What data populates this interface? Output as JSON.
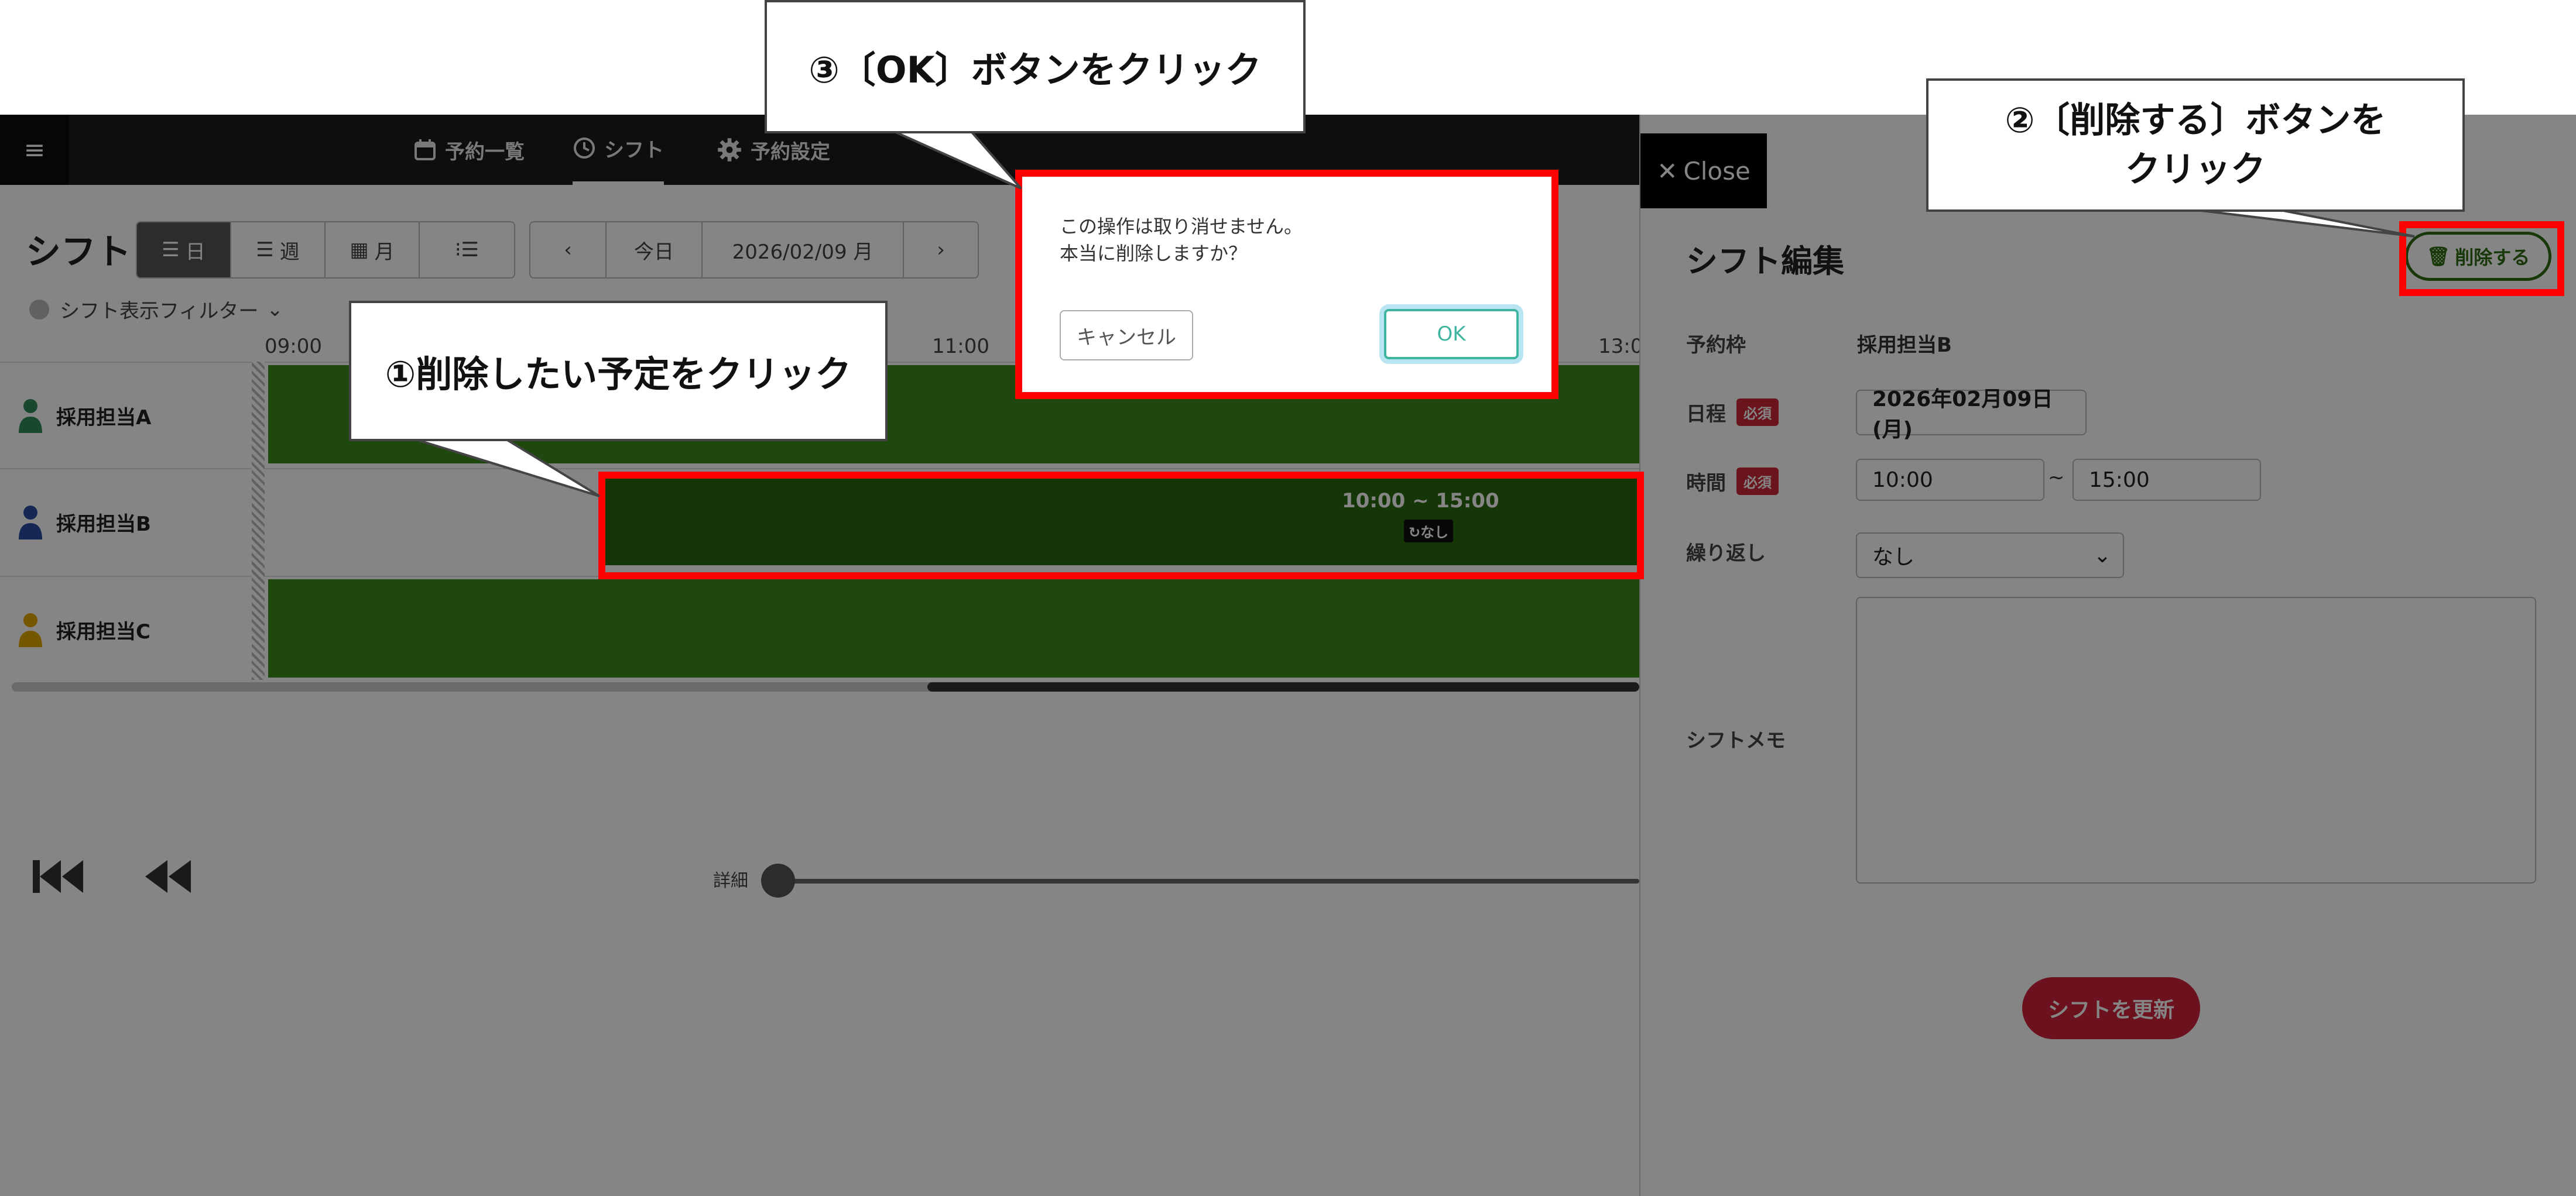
{
  "nav": {
    "menu_icon": "hamburger-icon",
    "items": [
      {
        "label": "予約一覧",
        "icon": "calendar-icon"
      },
      {
        "label": "シフト",
        "icon": "clock-icon"
      },
      {
        "label": "予約設定",
        "icon": "gear-icon"
      }
    ]
  },
  "toolbar": {
    "title": "シフト",
    "views": [
      {
        "label": "日",
        "icon": "list-icon"
      },
      {
        "label": "週",
        "icon": "list-icon"
      },
      {
        "label": "月",
        "icon": "calendar-icon"
      },
      {
        "label": "",
        "icon": "list-bullets-icon"
      }
    ],
    "today": "今日",
    "date": "2026/02/09 月"
  },
  "filter": {
    "label": "シフト表示フィルター"
  },
  "timeline": {
    "times": [
      "09:00",
      "11:00",
      "13:0"
    ],
    "rows": [
      {
        "name": "採用担当A",
        "avatar_color": "#2e8b57"
      },
      {
        "name": "採用担当B",
        "avatar_color": "#2a4da0"
      },
      {
        "name": "採用担当C",
        "avatar_color": "#e0a800"
      }
    ],
    "selected_shift": {
      "time": "10:00 ~ 15:00",
      "repeat": "なし"
    }
  },
  "zoom": {
    "label": "詳細"
  },
  "panel": {
    "close_label": "Close",
    "title": "シフト編集",
    "delete_label": "削除する",
    "fields": {
      "slot_label": "予約枠",
      "slot_value": "採用担当B",
      "date_label": "日程",
      "date_value": "2026年02月09日(月)",
      "time_label": "時間",
      "time_start": "10:00",
      "time_sep": "~",
      "time_end": "15:00",
      "repeat_label": "繰り返し",
      "repeat_value": "なし",
      "memo_label": "シフトメモ",
      "required": "必須"
    },
    "update_label": "シフトを更新"
  },
  "dialog": {
    "line1": "この操作は取り消せません。",
    "line2": "本当に削除しますか？",
    "cancel": "キャンセル",
    "ok": "OK"
  },
  "annotations": {
    "step1": "①削除したい予定をクリック",
    "step2_line1": "②〔削除する〕ボタンを",
    "step2_line2": "クリック",
    "step3": "③〔OK〕ボタンをクリック"
  },
  "colors": {
    "highlight": "#ff0000",
    "shift_green": "#3a8a1a",
    "delete_green": "#2e6b12",
    "update_red": "#d0243a",
    "ok_teal": "#3fb5a0"
  }
}
